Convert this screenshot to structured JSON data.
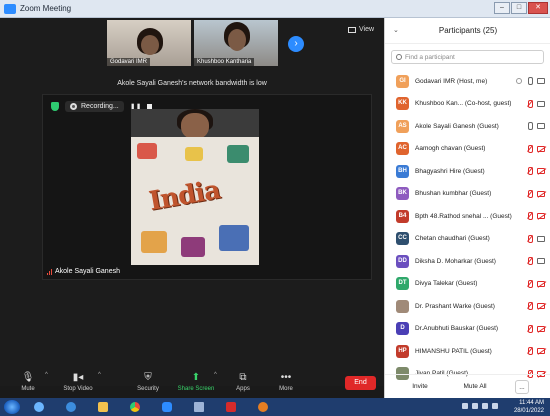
{
  "window": {
    "title": "Zoom Meeting"
  },
  "thumbnails": [
    {
      "name": "Godavari IMR"
    },
    {
      "name": "Khushboo Kantharia"
    }
  ],
  "view_label": "View",
  "bandwidth_notice": "Akole Sayali Ganesh's network bandwidth is low",
  "recording": {
    "label": "Recording..."
  },
  "main_video": {
    "name": "Akole Sayali Ganesh",
    "drawing_text": "India"
  },
  "toolbar": {
    "mute": "Mute",
    "stop_video": "Stop Video",
    "security": "Security",
    "share_screen": "Share Screen",
    "apps": "Apps",
    "more": "More",
    "end": "End"
  },
  "participants_panel": {
    "title": "Participants (25)",
    "search_placeholder": "Find a participant",
    "participants": [
      {
        "initials": "GI",
        "color": "#f0a05a",
        "name": "Godavari IMR (Host, me)",
        "mic": "on",
        "cam": "on",
        "host": true
      },
      {
        "initials": "KK",
        "color": "#e0642e",
        "name": "Khushboo Kan... (Co-host, guest)",
        "mic": "muted",
        "cam": "on",
        "host": false
      },
      {
        "initials": "AS",
        "color": "#f0a05a",
        "name": "Akole Sayali Ganesh (Guest)",
        "mic": "on",
        "cam": "on",
        "host": false
      },
      {
        "initials": "AC",
        "color": "#e0642e",
        "name": "Aamogh chavan (Guest)",
        "mic": "muted",
        "cam": "off",
        "host": false
      },
      {
        "initials": "BH",
        "color": "#3a7bd5",
        "name": "Bhagyashri Hire (Guest)",
        "mic": "muted",
        "cam": "off",
        "host": false
      },
      {
        "initials": "BK",
        "color": "#8e5bbf",
        "name": "Bhushan kumbhar (Guest)",
        "mic": "muted",
        "cam": "off",
        "host": false
      },
      {
        "initials": "B4",
        "color": "#c23b2b",
        "name": "Bpth 48.Rathod snehal ... (Guest)",
        "mic": "muted",
        "cam": "off",
        "host": false
      },
      {
        "initials": "CC",
        "color": "#2f4f6f",
        "name": "Chetan chaudhari (Guest)",
        "mic": "muted",
        "cam": "on",
        "host": false
      },
      {
        "initials": "DD",
        "color": "#6b4fbf",
        "name": "Diksha D. Moharkar (Guest)",
        "mic": "muted",
        "cam": "on",
        "host": false
      },
      {
        "initials": "DT",
        "color": "#2fa86b",
        "name": "Divya Talekar (Guest)",
        "mic": "muted",
        "cam": "off",
        "host": false
      },
      {
        "initials": "",
        "color": "#a08a78",
        "name": "Dr. Prashant Warke (Guest)",
        "mic": "muted",
        "cam": "off",
        "host": false
      },
      {
        "initials": "D",
        "color": "#4a3fb5",
        "name": "Dr.Anubhuti Bauskar (Guest)",
        "mic": "muted",
        "cam": "off",
        "host": false
      },
      {
        "initials": "HP",
        "color": "#c23b2b",
        "name": "HIMANSHU PATIL (Guest)",
        "mic": "muted",
        "cam": "off",
        "host": false
      },
      {
        "initials": "",
        "color": "#7d8a6a",
        "name": "Jivan Patil (Guest)",
        "mic": "muted",
        "cam": "off",
        "host": false
      }
    ],
    "invite_label": "Invite",
    "mute_all_label": "Mute All",
    "more_label": "..."
  },
  "taskbar": {
    "time": "11:44 AM",
    "date": "28/01/2022"
  }
}
